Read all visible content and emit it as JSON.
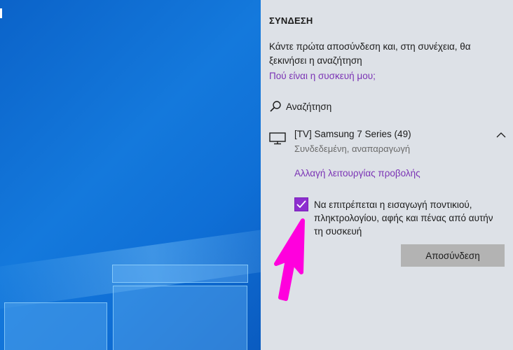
{
  "panel": {
    "title": "ΣΥΝΔΕΣΗ",
    "description": "Κάντε πρώτα αποσύνδεση και, στη συνέχεια, θα ξεκινήσει η αναζήτηση",
    "where_link": "Πού είναι η συσκευή μου;",
    "search_label": "Αναζήτηση",
    "device": {
      "name": "[TV] Samsung 7 Series (49)",
      "status": "Συνδεδεμένη, αναπαραγωγή",
      "icon": "tv-icon",
      "expand_icon": "chevron-up-icon"
    },
    "change_mode_link": "Αλλαγή λειτουργίας προβολής",
    "allow_input": {
      "checked": true,
      "label": "Να επιτρέπεται η εισαγωγή ποντικιού, πληκτρολογίου, αφής και πένας από αυτήν τη συσκευή"
    },
    "disconnect_label": "Αποσύνδεση"
  },
  "colors": {
    "accent": "#8d2ecf",
    "link": "#7a32b4",
    "panel_bg": "#dde1e7",
    "annotation_arrow": "#ff00dd"
  }
}
